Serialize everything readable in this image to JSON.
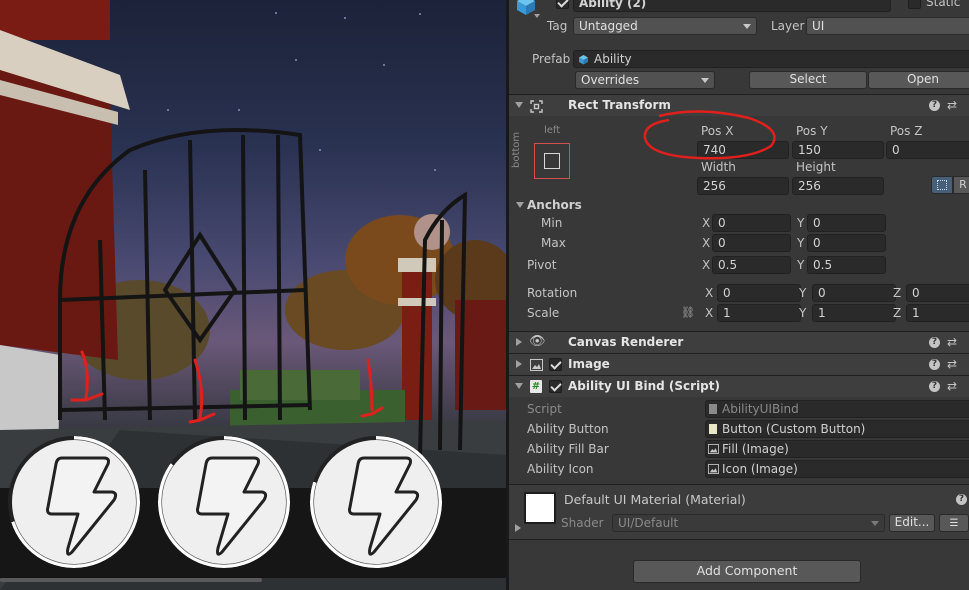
{
  "object": {
    "name": "Ability (2)",
    "static_label": "Static",
    "tag_label": "Tag",
    "tag_value": "Untagged",
    "layer_label": "Layer",
    "layer_value": "UI",
    "prefab_label": "Prefab",
    "prefab_value": "Ability",
    "overrides_label": "Overrides",
    "select_label": "Select",
    "open_label": "Open"
  },
  "rect_transform": {
    "title": "Rect Transform",
    "anchor_preset_h": "left",
    "anchor_preset_v": "bottom",
    "pos_x_label": "Pos X",
    "pos_x": "740",
    "pos_y_label": "Pos Y",
    "pos_y": "150",
    "pos_z_label": "Pos Z",
    "pos_z": "0",
    "width_label": "Width",
    "width": "256",
    "height_label": "Height",
    "height": "256",
    "raw_edit_label": "R",
    "anchors_label": "Anchors",
    "min_label": "Min",
    "min_x": "0",
    "min_y": "0",
    "max_label": "Max",
    "max_x": "0",
    "max_y": "0",
    "pivot_label": "Pivot",
    "pivot_x": "0.5",
    "pivot_y": "0.5",
    "rotation_label": "Rotation",
    "rot_x": "0",
    "rot_y": "0",
    "rot_z": "0",
    "scale_label": "Scale",
    "scale_x": "1",
    "scale_y": "1",
    "scale_z": "1",
    "x": "X",
    "y": "Y",
    "z": "Z"
  },
  "components": {
    "canvas_renderer": "Canvas Renderer",
    "image": "Image",
    "ability_ui_bind": "Ability UI Bind (Script)",
    "script_label": "Script",
    "script_value": "AbilityUIBind",
    "ability_button_label": "Ability Button",
    "ability_button_value": "Button (Custom Button)",
    "ability_fill_bar_label": "Ability Fill Bar",
    "ability_fill_bar_value": "Fill (Image)",
    "ability_icon_label": "Ability Icon",
    "ability_icon_value": "Icon (Image)"
  },
  "material": {
    "name": "Default UI Material (Material)",
    "shader_label": "Shader",
    "shader_value": "UI/Default",
    "edit_label": "Edit..."
  },
  "add_component_label": "Add Component",
  "game_view": {
    "abilities": [
      {
        "name": "ability-slot-1",
        "icon": "lightning-bolt-icon"
      },
      {
        "name": "ability-slot-2",
        "icon": "lightning-bolt-icon"
      },
      {
        "name": "ability-slot-3",
        "icon": "lightning-bolt-icon"
      }
    ]
  },
  "colors": {
    "inspector_bg": "#383838",
    "field_bg": "#2a2a2a",
    "annotation_red": "#e0201c",
    "ability_bg": "#efefef"
  }
}
